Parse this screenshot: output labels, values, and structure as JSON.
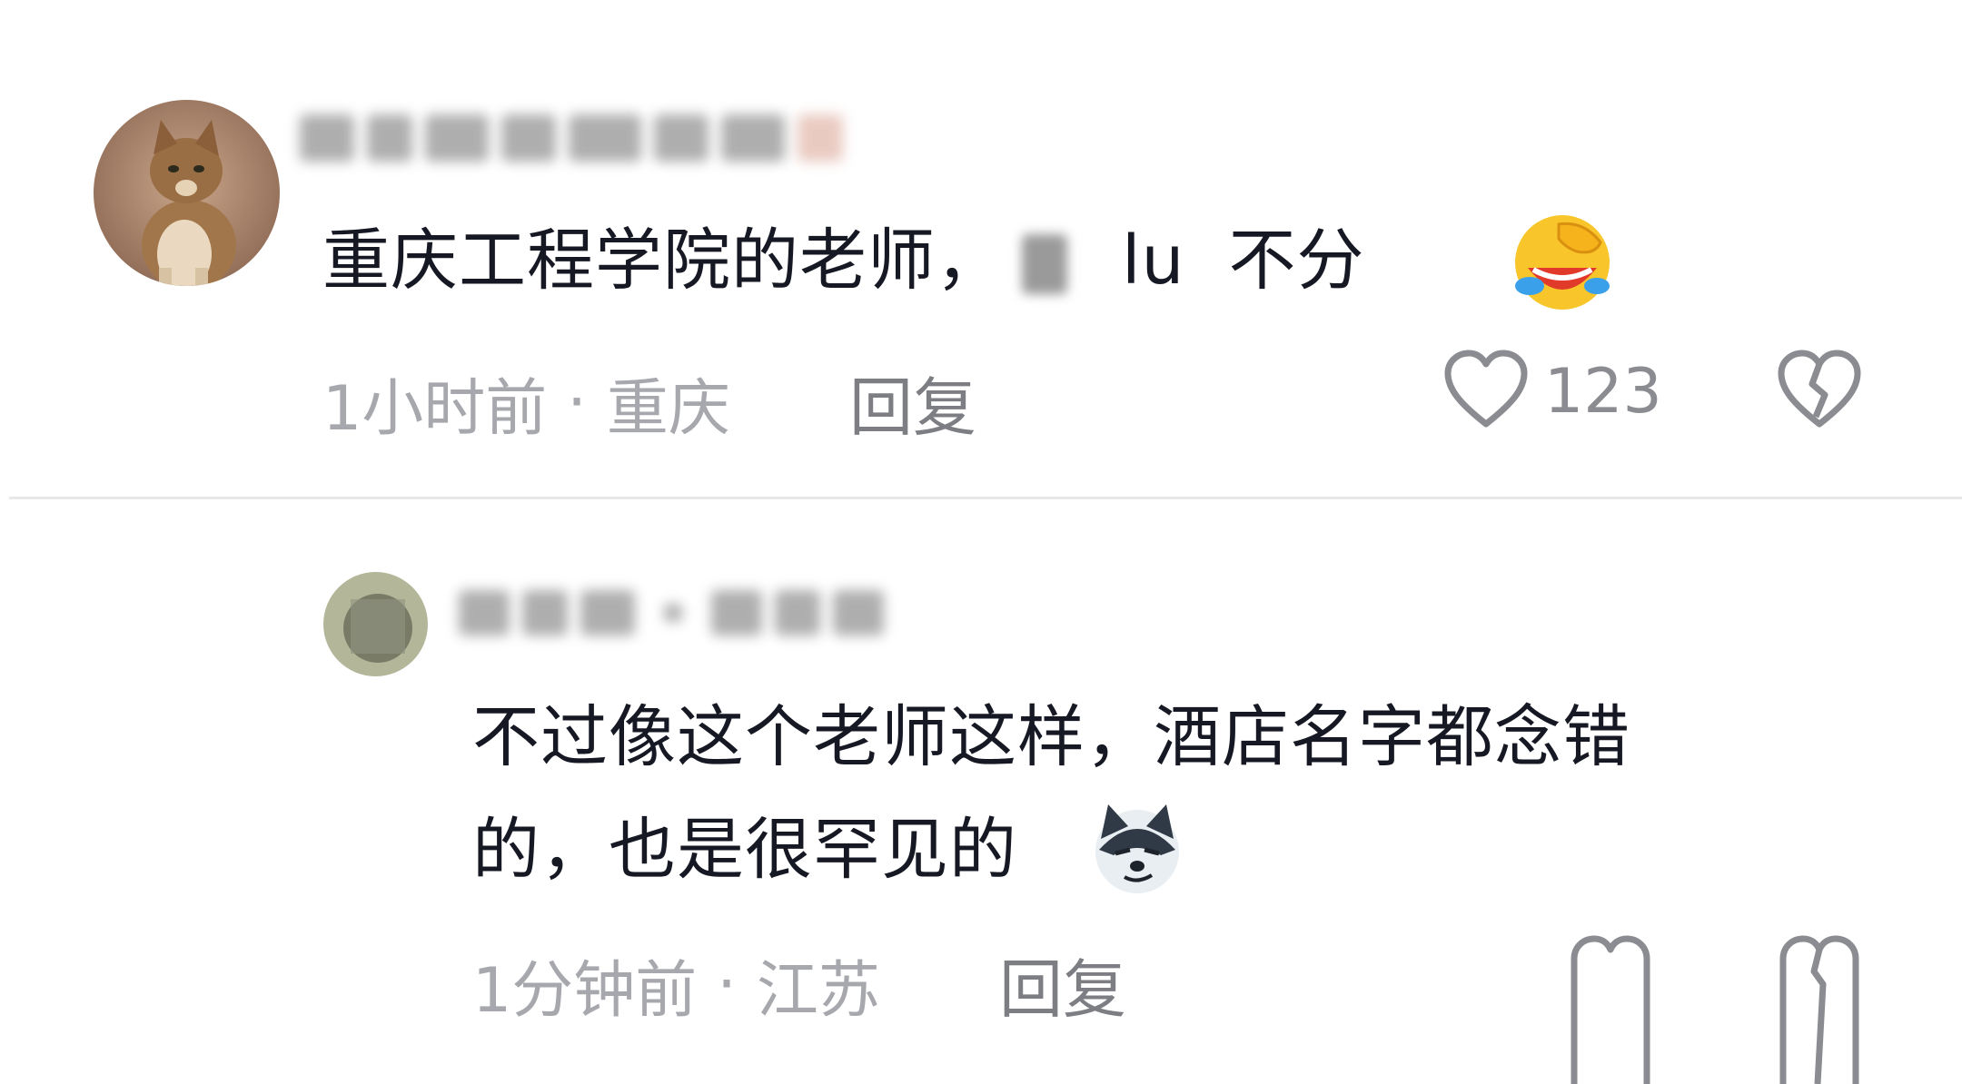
{
  "comment": {
    "text_part1": "重庆工程学院的老师，",
    "text_part2": "lu",
    "text_part3": "不分",
    "emoji": "laughing-crying-emoji",
    "time": "1小时前",
    "location": "重庆",
    "reply_label": "回复",
    "like_count": "123"
  },
  "reply": {
    "text_line1": "不过像这个老师这样，酒店名字都念错",
    "text_line2": "的，也是很罕见的",
    "emoji": "smirking-husky-emoji",
    "time": "1分钟前",
    "location": "江苏",
    "reply_label": "回复"
  },
  "meta_separator": "·",
  "colors": {
    "text": "#161823",
    "meta": "#a7a8ad",
    "divider": "#e8e8ea"
  }
}
